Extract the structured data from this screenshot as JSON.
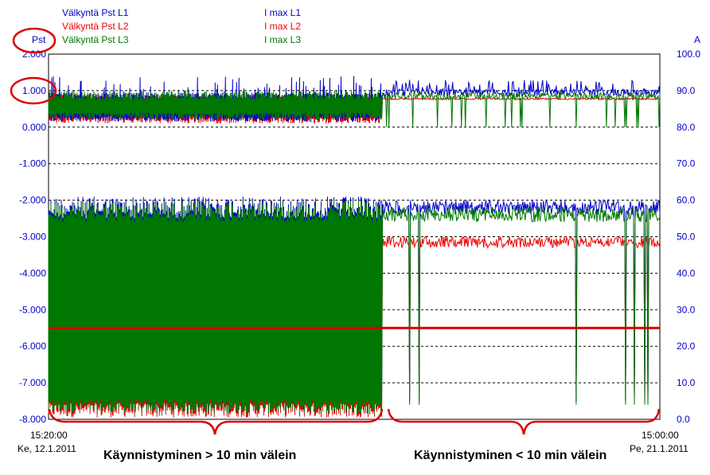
{
  "chart_data": {
    "type": "line",
    "legend_left": [
      {
        "label": "Välkyntä Pst L1",
        "color": "#0000cc"
      },
      {
        "label": "Välkyntä Pst L2",
        "color": "#ee0000"
      },
      {
        "label": "Välkyntä Pst L3",
        "color": "#007700"
      }
    ],
    "legend_right": [
      {
        "label": "I max L1",
        "color": "#0000cc"
      },
      {
        "label": "I max L2",
        "color": "#ee0000"
      },
      {
        "label": "I max L3",
        "color": "#007700"
      }
    ],
    "y_left": {
      "label": "Pst",
      "min": -8,
      "max": 2,
      "ticks": [
        "2.000",
        "1.000",
        "0.000",
        "-1.000",
        "-2.000",
        "-3.000",
        "-4.000",
        "-5.000",
        "-6.000",
        "-7.000",
        "-8.000"
      ]
    },
    "y_right": {
      "label": "A",
      "min": 0,
      "max": 100,
      "ticks": [
        "100.0",
        "90.0",
        "80.0",
        "70.0",
        "60.0",
        "50.0",
        "40.0",
        "30.0",
        "20.0",
        "10.0",
        "0.0"
      ]
    },
    "x_start": {
      "time": "15:20:00",
      "date": "Ke, 12.1.2011"
    },
    "x_end": {
      "time": "15:00:00",
      "date": "Pe, 21.1.2011"
    },
    "reference_line_pst": -5.5,
    "annotations": {
      "left_caption": "Käynnistyminen > 10 min välein",
      "right_caption": "Käynnistyminen < 10 min välein",
      "circled_labels": [
        "Pst",
        "1.000"
      ]
    },
    "grid": true,
    "series_summary": {
      "pst_typical": 0.75,
      "pst_peak": 1.0,
      "current_period1_min_A": 0.5,
      "current_period1_max_A": 60,
      "current_period2_L1_L3_A": 60,
      "current_period2_L2_A": 50,
      "current_idle_A": 0
    }
  }
}
